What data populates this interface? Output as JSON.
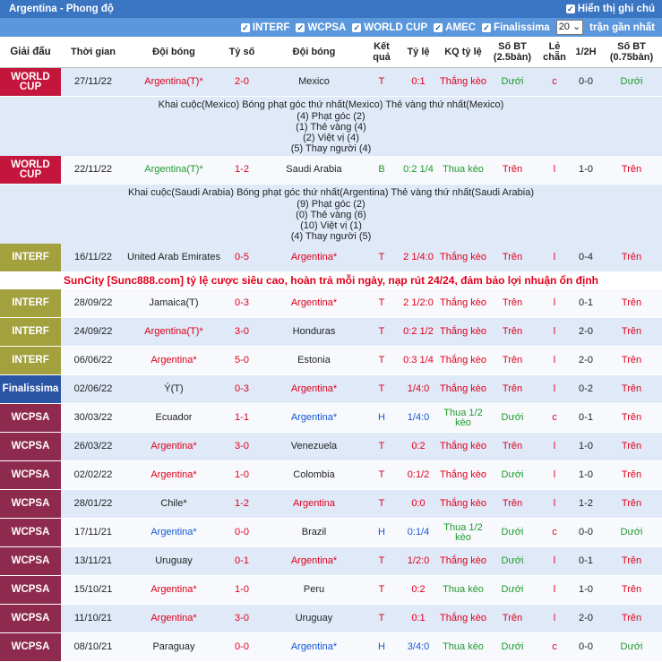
{
  "header": {
    "title": "Argentina - Phong độ",
    "show_notes_label": "Hiển thị ghi chú"
  },
  "filters": {
    "items": [
      "INTERF",
      "WCPSA",
      "WORLD CUP",
      "AMEC",
      "Finalissima"
    ],
    "count_value": "20",
    "count_suffix": "trận gần nhất"
  },
  "columns": {
    "league": "Giải đấu",
    "date": "Thời gian",
    "home": "Đội bóng",
    "score": "Tỷ số",
    "away": "Đội bóng",
    "result": "Kết quả",
    "rate": "Tỷ lệ",
    "kq_rate": "KQ tỷ lệ",
    "ou": "Số BT (2.5bàn)",
    "oe": "Lẻ chẵn",
    "half": "1/2H",
    "ou2": "Số BT (0.75bàn)"
  },
  "colors": {
    "worldcup": "#c4163d",
    "interf": "#a3a13e",
    "wcpsa": "#8d2a4e",
    "finalissima": "#2a55a4"
  },
  "promo": "SunCity [Sunc888.com] tỷ lệ cược siêu cao, hoàn trả mỗi ngày, nạp rút 24/24, đảm bảo lợi nhuận ổn định",
  "rows": [
    {
      "league": "WORLD CUP",
      "lc": "#c4163d",
      "date": "27/11/22",
      "home": "Argentina(T)*",
      "hc": "red",
      "score": "2-0",
      "sc": "red",
      "away": "Mexico",
      "ac": "black",
      "res": "T",
      "rc": "red",
      "rate": "0:1",
      "kq": "Thắng kèo",
      "kc": "red",
      "ou": "Dưới",
      "oc": "green",
      "oe": "c",
      "ec": "red",
      "half": "0-0",
      "ou2": "Dưới",
      "o2c": "green",
      "detail": {
        "line1": "Khai cuộc(Mexico)  Bóng phạt góc thứ nhất(Mexico)  Thẻ vàng thứ nhất(Mexico)",
        "lines": [
          "(4) Phạt góc (2)",
          "(1) Thẻ vàng (4)",
          "(2) Việt vị (4)",
          "(5) Thay người (4)"
        ]
      }
    },
    {
      "league": "WORLD CUP",
      "lc": "#c4163d",
      "date": "22/11/22",
      "home": "Argentina(T)*",
      "hc": "green",
      "score": "1-2",
      "sc": "red",
      "away": "Saudi Arabia",
      "ac": "black",
      "res": "B",
      "rc": "green",
      "rate": "0:2 1/4",
      "kq": "Thua kèo",
      "kc": "green",
      "ou": "Trên",
      "oc": "red",
      "oe": "l",
      "ec": "red",
      "half": "1-0",
      "ou2": "Trên",
      "o2c": "red",
      "detail": {
        "line1": "Khai cuộc(Saudi Arabia)  Bóng phạt góc thứ nhất(Argentina)  Thẻ vàng thứ nhất(Saudi Arabia)",
        "lines": [
          "(9) Phạt góc (2)",
          "(0) Thẻ vàng (6)",
          "(10) Việt vị (1)",
          "(4) Thay người (5)"
        ]
      }
    },
    {
      "league": "INTERF",
      "lc": "#a3a13e",
      "date": "16/11/22",
      "home": "United Arab Emirates",
      "hc": "black",
      "score": "0-5",
      "sc": "red",
      "away": "Argentina*",
      "ac": "red",
      "res": "T",
      "rc": "red",
      "rate": "2 1/4:0",
      "kq": "Thắng kèo",
      "kc": "red",
      "ou": "Trên",
      "oc": "red",
      "oe": "l",
      "ec": "red",
      "half": "0-4",
      "ou2": "Trên",
      "o2c": "red",
      "promo_after": true
    },
    {
      "league": "INTERF",
      "lc": "#a3a13e",
      "date": "28/09/22",
      "home": "Jamaica(T)",
      "hc": "black",
      "score": "0-3",
      "sc": "red",
      "away": "Argentina*",
      "ac": "red",
      "res": "T",
      "rc": "red",
      "rate": "2 1/2:0",
      "kq": "Thắng kèo",
      "kc": "red",
      "ou": "Trên",
      "oc": "red",
      "oe": "l",
      "ec": "red",
      "half": "0-1",
      "ou2": "Trên",
      "o2c": "red"
    },
    {
      "league": "INTERF",
      "lc": "#a3a13e",
      "date": "24/09/22",
      "home": "Argentina(T)*",
      "hc": "red",
      "score": "3-0",
      "sc": "red",
      "away": "Honduras",
      "ac": "black",
      "res": "T",
      "rc": "red",
      "rate": "0:2 1/2",
      "kq": "Thắng kèo",
      "kc": "red",
      "ou": "Trên",
      "oc": "red",
      "oe": "l",
      "ec": "red",
      "half": "2-0",
      "ou2": "Trên",
      "o2c": "red"
    },
    {
      "league": "INTERF",
      "lc": "#a3a13e",
      "date": "06/06/22",
      "home": "Argentina*",
      "hc": "red",
      "score": "5-0",
      "sc": "red",
      "away": "Estonia",
      "ac": "black",
      "res": "T",
      "rc": "red",
      "rate": "0:3 1/4",
      "kq": "Thắng kèo",
      "kc": "red",
      "ou": "Trên",
      "oc": "red",
      "oe": "l",
      "ec": "red",
      "half": "2-0",
      "ou2": "Trên",
      "o2c": "red"
    },
    {
      "league": "Finalissima",
      "lc": "#2a55a4",
      "date": "02/06/22",
      "home": "Ý(T)",
      "hc": "black",
      "score": "0-3",
      "sc": "red",
      "away": "Argentina*",
      "ac": "red",
      "res": "T",
      "rc": "red",
      "rate": "1/4:0",
      "kq": "Thắng kèo",
      "kc": "red",
      "ou": "Trên",
      "oc": "red",
      "oe": "l",
      "ec": "red",
      "half": "0-2",
      "ou2": "Trên",
      "o2c": "red"
    },
    {
      "league": "WCPSA",
      "lc": "#8d2a4e",
      "date": "30/03/22",
      "home": "Ecuador",
      "hc": "black",
      "score": "1-1",
      "sc": "red",
      "away": "Argentina*",
      "ac": "blue",
      "res": "H",
      "rc": "blue",
      "rate": "1/4:0",
      "kq": "Thua 1/2 kèo",
      "kc": "green",
      "ou": "Dưới",
      "oc": "green",
      "oe": "c",
      "ec": "red",
      "half": "0-1",
      "ou2": "Trên",
      "o2c": "red"
    },
    {
      "league": "WCPSA",
      "lc": "#8d2a4e",
      "date": "26/03/22",
      "home": "Argentina*",
      "hc": "red",
      "score": "3-0",
      "sc": "red",
      "away": "Venezuela",
      "ac": "black",
      "res": "T",
      "rc": "red",
      "rate": "0:2",
      "kq": "Thắng kèo",
      "kc": "red",
      "ou": "Trên",
      "oc": "red",
      "oe": "l",
      "ec": "red",
      "half": "1-0",
      "ou2": "Trên",
      "o2c": "red"
    },
    {
      "league": "WCPSA",
      "lc": "#8d2a4e",
      "date": "02/02/22",
      "home": "Argentina*",
      "hc": "red",
      "score": "1-0",
      "sc": "red",
      "away": "Colombia",
      "ac": "black",
      "res": "T",
      "rc": "red",
      "rate": "0:1/2",
      "kq": "Thắng kèo",
      "kc": "red",
      "ou": "Dưới",
      "oc": "green",
      "oe": "l",
      "ec": "red",
      "half": "1-0",
      "ou2": "Trên",
      "o2c": "red"
    },
    {
      "league": "WCPSA",
      "lc": "#8d2a4e",
      "date": "28/01/22",
      "home": "Chile*",
      "hc": "black",
      "score": "1-2",
      "sc": "red",
      "away": "Argentina",
      "ac": "red",
      "res": "T",
      "rc": "red",
      "rate": "0:0",
      "kq": "Thắng kèo",
      "kc": "red",
      "ou": "Trên",
      "oc": "red",
      "oe": "l",
      "ec": "red",
      "half": "1-2",
      "ou2": "Trên",
      "o2c": "red"
    },
    {
      "league": "WCPSA",
      "lc": "#8d2a4e",
      "date": "17/11/21",
      "home": "Argentina*",
      "hc": "blue",
      "score": "0-0",
      "sc": "red",
      "away": "Brazil",
      "ac": "black",
      "res": "H",
      "rc": "blue",
      "rate": "0:1/4",
      "kq": "Thua 1/2 kèo",
      "kc": "green",
      "ou": "Dưới",
      "oc": "green",
      "oe": "c",
      "ec": "red",
      "half": "0-0",
      "ou2": "Dưới",
      "o2c": "green"
    },
    {
      "league": "WCPSA",
      "lc": "#8d2a4e",
      "date": "13/11/21",
      "home": "Uruguay",
      "hc": "black",
      "score": "0-1",
      "sc": "red",
      "away": "Argentina*",
      "ac": "red",
      "res": "T",
      "rc": "red",
      "rate": "1/2:0",
      "kq": "Thắng kèo",
      "kc": "red",
      "ou": "Dưới",
      "oc": "green",
      "oe": "l",
      "ec": "red",
      "half": "0-1",
      "ou2": "Trên",
      "o2c": "red"
    },
    {
      "league": "WCPSA",
      "lc": "#8d2a4e",
      "date": "15/10/21",
      "home": "Argentina*",
      "hc": "red",
      "score": "1-0",
      "sc": "red",
      "away": "Peru",
      "ac": "black",
      "res": "T",
      "rc": "red",
      "rate": "0:2",
      "kq": "Thua kèo",
      "kc": "green",
      "ou": "Dưới",
      "oc": "green",
      "oe": "l",
      "ec": "red",
      "half": "1-0",
      "ou2": "Trên",
      "o2c": "red"
    },
    {
      "league": "WCPSA",
      "lc": "#8d2a4e",
      "date": "11/10/21",
      "home": "Argentina*",
      "hc": "red",
      "score": "3-0",
      "sc": "red",
      "away": "Uruguay",
      "ac": "black",
      "res": "T",
      "rc": "red",
      "rate": "0:1",
      "kq": "Thắng kèo",
      "kc": "red",
      "ou": "Trên",
      "oc": "red",
      "oe": "l",
      "ec": "red",
      "half": "2-0",
      "ou2": "Trên",
      "o2c": "red"
    },
    {
      "league": "WCPSA",
      "lc": "#8d2a4e",
      "date": "08/10/21",
      "home": "Paraguay",
      "hc": "black",
      "score": "0-0",
      "sc": "red",
      "away": "Argentina*",
      "ac": "blue",
      "res": "H",
      "rc": "blue",
      "rate": "3/4:0",
      "kq": "Thua kèo",
      "kc": "green",
      "ou": "Dưới",
      "oc": "green",
      "oe": "c",
      "ec": "red",
      "half": "0-0",
      "ou2": "Dưới",
      "o2c": "green"
    }
  ]
}
